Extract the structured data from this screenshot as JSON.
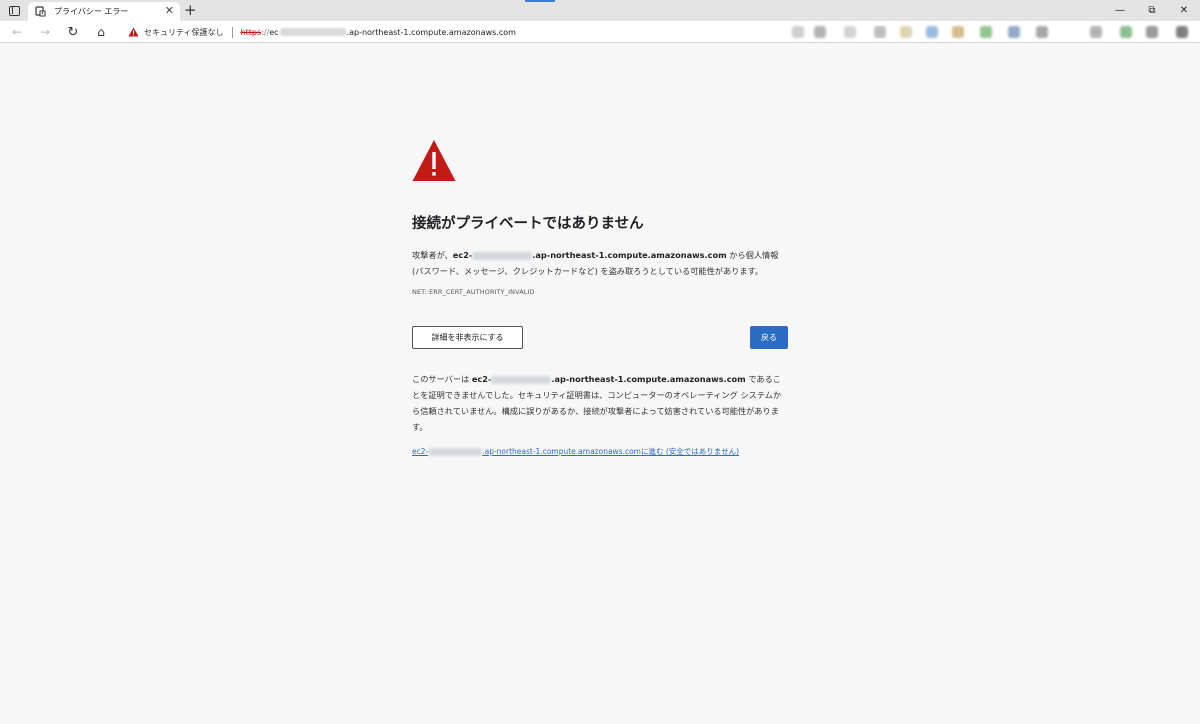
{
  "browser": {
    "tab": {
      "title": "プライバシー エラー",
      "close_glyph": "✕"
    },
    "new_tab_glyph": "+",
    "window_controls": {
      "minimize": "—",
      "restore": "⧉",
      "close": "✕"
    },
    "nav": {
      "back": "←",
      "forward": "→",
      "reload": "↻",
      "home": "⌂"
    },
    "omnibox": {
      "security_label": "セキュリティ保護なし",
      "scheme": "https",
      "scheme_sep": "://",
      "host_prefix": "ec",
      "host_suffix": ".ap-northeast-1.compute.amazonaws.com"
    },
    "extension_icon_colors": [
      "#bfbfbf",
      "#9a9a9a",
      "#c7c7c7",
      "#a6a6a6",
      "#d8c79a",
      "#7aa3d8",
      "#c9a66b",
      "#6db56d",
      "#6f8fb4",
      "#8a8a8a",
      "#9c9c9c",
      "#6aa86a",
      "#777777",
      "#555555"
    ]
  },
  "page": {
    "heading": "接続がプライベートではありません",
    "main_message": {
      "before": "攻撃者が、",
      "host_prefix": "ec2-",
      "host_suffix": ".ap-northeast-1.compute.amazonaws.com",
      "after": " から個人情報 (パスワード、メッセージ、クレジットカードなど) を盗み取ろうとしている可能性があります。"
    },
    "error_code": "NET::ERR_CERT_AUTHORITY_INVALID",
    "details_button": "詳細を非表示にする",
    "back_button": "戻る",
    "detail_message": {
      "before": "このサーバーは ",
      "host_prefix": "ec2-",
      "host_suffix": ".ap-northeast-1.compute.amazonaws.com",
      "after": " であることを証明できませんでした。セキュリティ証明書は、コンピューターのオペレーティング システムから信頼されていません。構成に誤りがあるか、接続が攻撃者によって妨害されている可能性があります。"
    },
    "proceed_link": {
      "host_prefix": "ec2-",
      "host_suffix": ".ap-northeast-1.compute.amazonaws.com",
      "after": " に進む (安全ではありません)"
    }
  },
  "colors": {
    "warning_red": "#c41a16",
    "primary_blue": "#2b6cc4",
    "page_bg": "#f7f7f7"
  }
}
